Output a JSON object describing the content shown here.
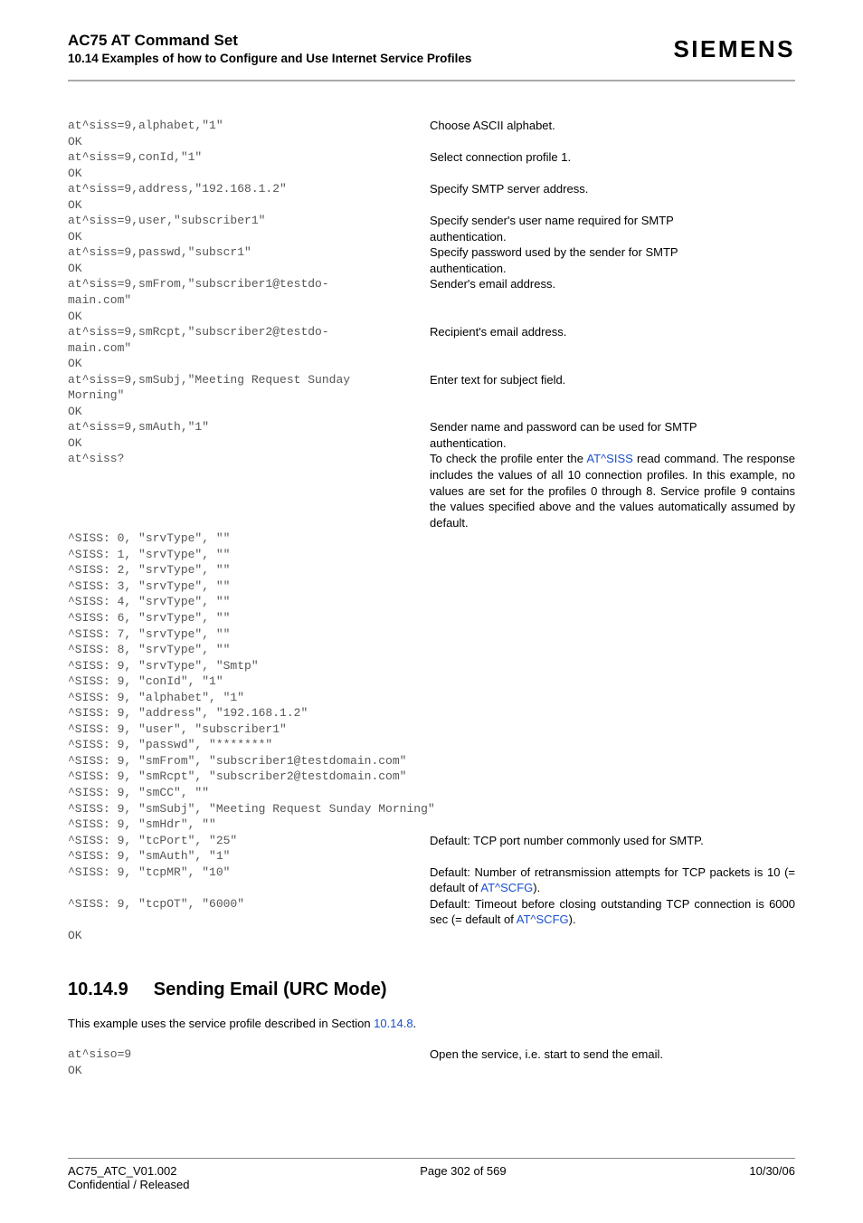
{
  "header": {
    "doc_title": "AC75 AT Command Set",
    "doc_subtitle": "10.14 Examples of how to Configure and Use Internet Service Profiles",
    "brand": "SIEMENS"
  },
  "rows": [
    {
      "l": "at^siss=9,alphabet,\"1\"",
      "r": "Choose ASCII alphabet."
    },
    {
      "l": "OK",
      "r": ""
    },
    {
      "l": "at^siss=9,conId,\"1\"",
      "r": "Select connection profile 1."
    },
    {
      "l": "OK",
      "r": ""
    },
    {
      "l": "at^siss=9,address,\"192.168.1.2\"",
      "r": "Specify SMTP server address."
    },
    {
      "l": "OK",
      "r": ""
    },
    {
      "l": "at^siss=9,user,\"subscriber1\"",
      "r": "Specify sender's user name required for SMTP"
    },
    {
      "l": "OK",
      "r": "authentication."
    },
    {
      "l": "at^siss=9,passwd,\"subscr1\"",
      "r": "Specify password used by the sender for SMTP"
    },
    {
      "l": "OK",
      "r": "authentication."
    },
    {
      "l": "at^siss=9,smFrom,\"subscriber1@testdo-",
      "r": "Sender's email address."
    },
    {
      "l": "main.com\"",
      "r": ""
    },
    {
      "l": "OK",
      "r": ""
    },
    {
      "l": "at^siss=9,smRcpt,\"subscriber2@testdo-",
      "r": "Recipient's email address."
    },
    {
      "l": "main.com\"",
      "r": ""
    },
    {
      "l": "OK",
      "r": ""
    },
    {
      "l": "at^siss=9,smSubj,\"Meeting Request Sunday",
      "r": "Enter text for subject field."
    },
    {
      "l": "Morning\"",
      "r": ""
    },
    {
      "l": "OK",
      "r": ""
    },
    {
      "l": "at^siss=9,smAuth,\"1\"",
      "r": "Sender name and password can be used for SMTP"
    },
    {
      "l": "OK",
      "r": "authentication."
    }
  ],
  "siss_query": {
    "cmd": "at^siss?",
    "desc_pre": "To check the profile enter the ",
    "desc_link": "AT^SISS",
    "desc_post": " read command. The response includes the values of all 10 connection profiles. In this example, no values are set for the profiles 0 through 8. Service profile 9 contains the values specified above and the values automatically assumed by default."
  },
  "siss_block": "^SISS: 0, \"srvType\", \"\"\n^SISS: 1, \"srvType\", \"\"\n^SISS: 2, \"srvType\", \"\"\n^SISS: 3, \"srvType\", \"\"\n^SISS: 4, \"srvType\", \"\"\n^SISS: 6, \"srvType\", \"\"\n^SISS: 7, \"srvType\", \"\"\n^SISS: 8, \"srvType\", \"\"\n^SISS: 9, \"srvType\", \"Smtp\"\n^SISS: 9, \"conId\", \"1\"\n^SISS: 9, \"alphabet\", \"1\"\n^SISS: 9, \"address\", \"192.168.1.2\"\n^SISS: 9, \"user\", \"subscriber1\"\n^SISS: 9, \"passwd\", \"*******\"\n^SISS: 9, \"smFrom\", \"subscriber1@testdomain.com\"\n^SISS: 9, \"smRcpt\", \"subscriber2@testdomain.com\"\n^SISS: 9, \"smCC\", \"\"\n^SISS: 9, \"smSubj\", \"Meeting Request Sunday Morning\"\n^SISS: 9, \"smHdr\", \"\"",
  "tail_rows": [
    {
      "l": "^SISS: 9, \"tcPort\", \"25\"",
      "r": "Default: TCP port number commonly used for SMTP."
    },
    {
      "l": "^SISS: 9, \"smAuth\", \"1\"",
      "r": ""
    }
  ],
  "tcpmr": {
    "l": "^SISS: 9, \"tcpMR\", \"10\"",
    "r_pre": "Default: Number of retransmission attempts for TCP packets is 10 (= default of ",
    "r_link": "AT^SCFG",
    "r_post": ")."
  },
  "tcpot": {
    "l": "^SISS: 9, \"tcpOT\", \"6000\"",
    "r_pre": "Default: Timeout before closing outstanding TCP connection is 6000 sec (= default of ",
    "r_link": "AT^SCFG",
    "r_post": ")."
  },
  "ok_final": "OK",
  "section": {
    "num": "10.14.9",
    "title": "Sending Email (URC Mode)",
    "intro_pre": "This example uses the service profile described in Section ",
    "intro_link": "10.14.8",
    "intro_post": "."
  },
  "section_rows": [
    {
      "l": "at^siso=9",
      "r": "Open the service, i.e. start to send the email."
    },
    {
      "l": "OK",
      "r": ""
    }
  ],
  "footer": {
    "left": "AC75_ATC_V01.002",
    "center": "Page 302 of 569",
    "right": "10/30/06",
    "sub": "Confidential / Released"
  }
}
